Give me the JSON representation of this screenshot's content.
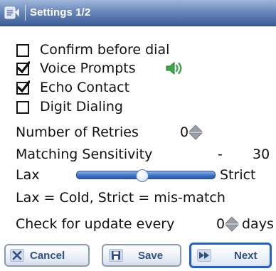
{
  "title_bar": {
    "title": "Settings 1/2"
  },
  "options": [
    {
      "label": "Confirm before dial",
      "checked": false
    },
    {
      "label": "Voice Prompts",
      "checked": true
    },
    {
      "label": "Echo Contact",
      "checked": true
    },
    {
      "label": "Digit Dialing",
      "checked": false
    }
  ],
  "retries": {
    "label": "Number of Retries",
    "value": "0"
  },
  "sensitivity": {
    "label": "Matching Sensitivity",
    "sign": "-",
    "value": "30",
    "min_label": "Lax",
    "max_label": "Strict",
    "level_fraction": 0.47,
    "note": "Lax = Cold, Strict = mis-match"
  },
  "update": {
    "label": "Check for update every",
    "value": "0",
    "unit": "days"
  },
  "buttons": {
    "cancel": "Cancel",
    "save": "Save",
    "next": "Next"
  },
  "colors": {
    "title_bar": "#4d6ea5",
    "slider_fill": "#3f73c9",
    "button_text": "#2f4f86",
    "next_border": "#1f5fd0",
    "speaker": "#3aa84a"
  }
}
